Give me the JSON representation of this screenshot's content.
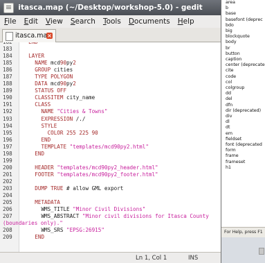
{
  "window": {
    "title": "itasca.map (~/Desktop/workshop-5.0) - gedit",
    "menu": [
      "File",
      "Edit",
      "View",
      "Search",
      "Tools",
      "Documents",
      "Help"
    ],
    "tab_label": "itasca.map",
    "status_position": "Ln 1, Col 1",
    "status_mode": "INS"
  },
  "background_window": {
    "items": [
      "area",
      "b",
      "base",
      "basefont (deprec",
      "bdo",
      "big",
      "blockquote",
      "body",
      "br",
      "button",
      "caption",
      "center (deprecated",
      "cite",
      "code",
      "col",
      "colgroup",
      "dd",
      "del",
      "dfn",
      "dir (deprecated)",
      "div",
      "dl",
      "dt",
      "em",
      "fieldset",
      "font (deprecated",
      "form",
      "frame",
      "frameset",
      "h1"
    ],
    "status": "For Help, press F1"
  },
  "code_lines": [
    {
      "n": "182",
      "t": "  END"
    },
    {
      "n": "183",
      "t": ""
    },
    {
      "n": "184",
      "t": "  LAYER"
    },
    {
      "n": "185",
      "t": "    NAME mcd90py2"
    },
    {
      "n": "186",
      "t": "    GROUP cities"
    },
    {
      "n": "187",
      "t": "    TYPE POLYGON"
    },
    {
      "n": "188",
      "t": "    DATA mcd90py2"
    },
    {
      "n": "189",
      "t": "    STATUS OFF"
    },
    {
      "n": "190",
      "t": "    CLASSITEM city_name"
    },
    {
      "n": "191",
      "t": "    CLASS"
    },
    {
      "n": "192",
      "t": "      NAME \"Cities & Towns\""
    },
    {
      "n": "193",
      "t": "      EXPRESSION /./"
    },
    {
      "n": "194",
      "t": "      STYLE"
    },
    {
      "n": "195",
      "t": "        COLOR 255 225 90"
    },
    {
      "n": "196",
      "t": "      END"
    },
    {
      "n": "197",
      "t": "      TEMPLATE \"templates/mcd90py2.html\""
    },
    {
      "n": "198",
      "t": "    END"
    },
    {
      "n": "199",
      "t": ""
    },
    {
      "n": "200",
      "t": "    HEADER \"templates/mcd90py2_header.html\""
    },
    {
      "n": "201",
      "t": "    FOOTER \"templates/mcd90py2_footer.html\""
    },
    {
      "n": "202",
      "t": ""
    },
    {
      "n": "203",
      "t": "    DUMP TRUE # allow GML export"
    },
    {
      "n": "204",
      "t": ""
    },
    {
      "n": "205",
      "t": "    METADATA"
    },
    {
      "n": "206",
      "t": "      WMS_TITLE \"Minor Civil Divisions\""
    },
    {
      "n": "207",
      "t": "      WMS_ABSTRACT \"Minor civil divisions for Itasca County"
    },
    {
      "n": "",
      "t": "(boundaries only).\""
    },
    {
      "n": "208",
      "t": "      WMS_SRS \"EPSG:26915\""
    },
    {
      "n": "209",
      "t": "    END"
    }
  ]
}
